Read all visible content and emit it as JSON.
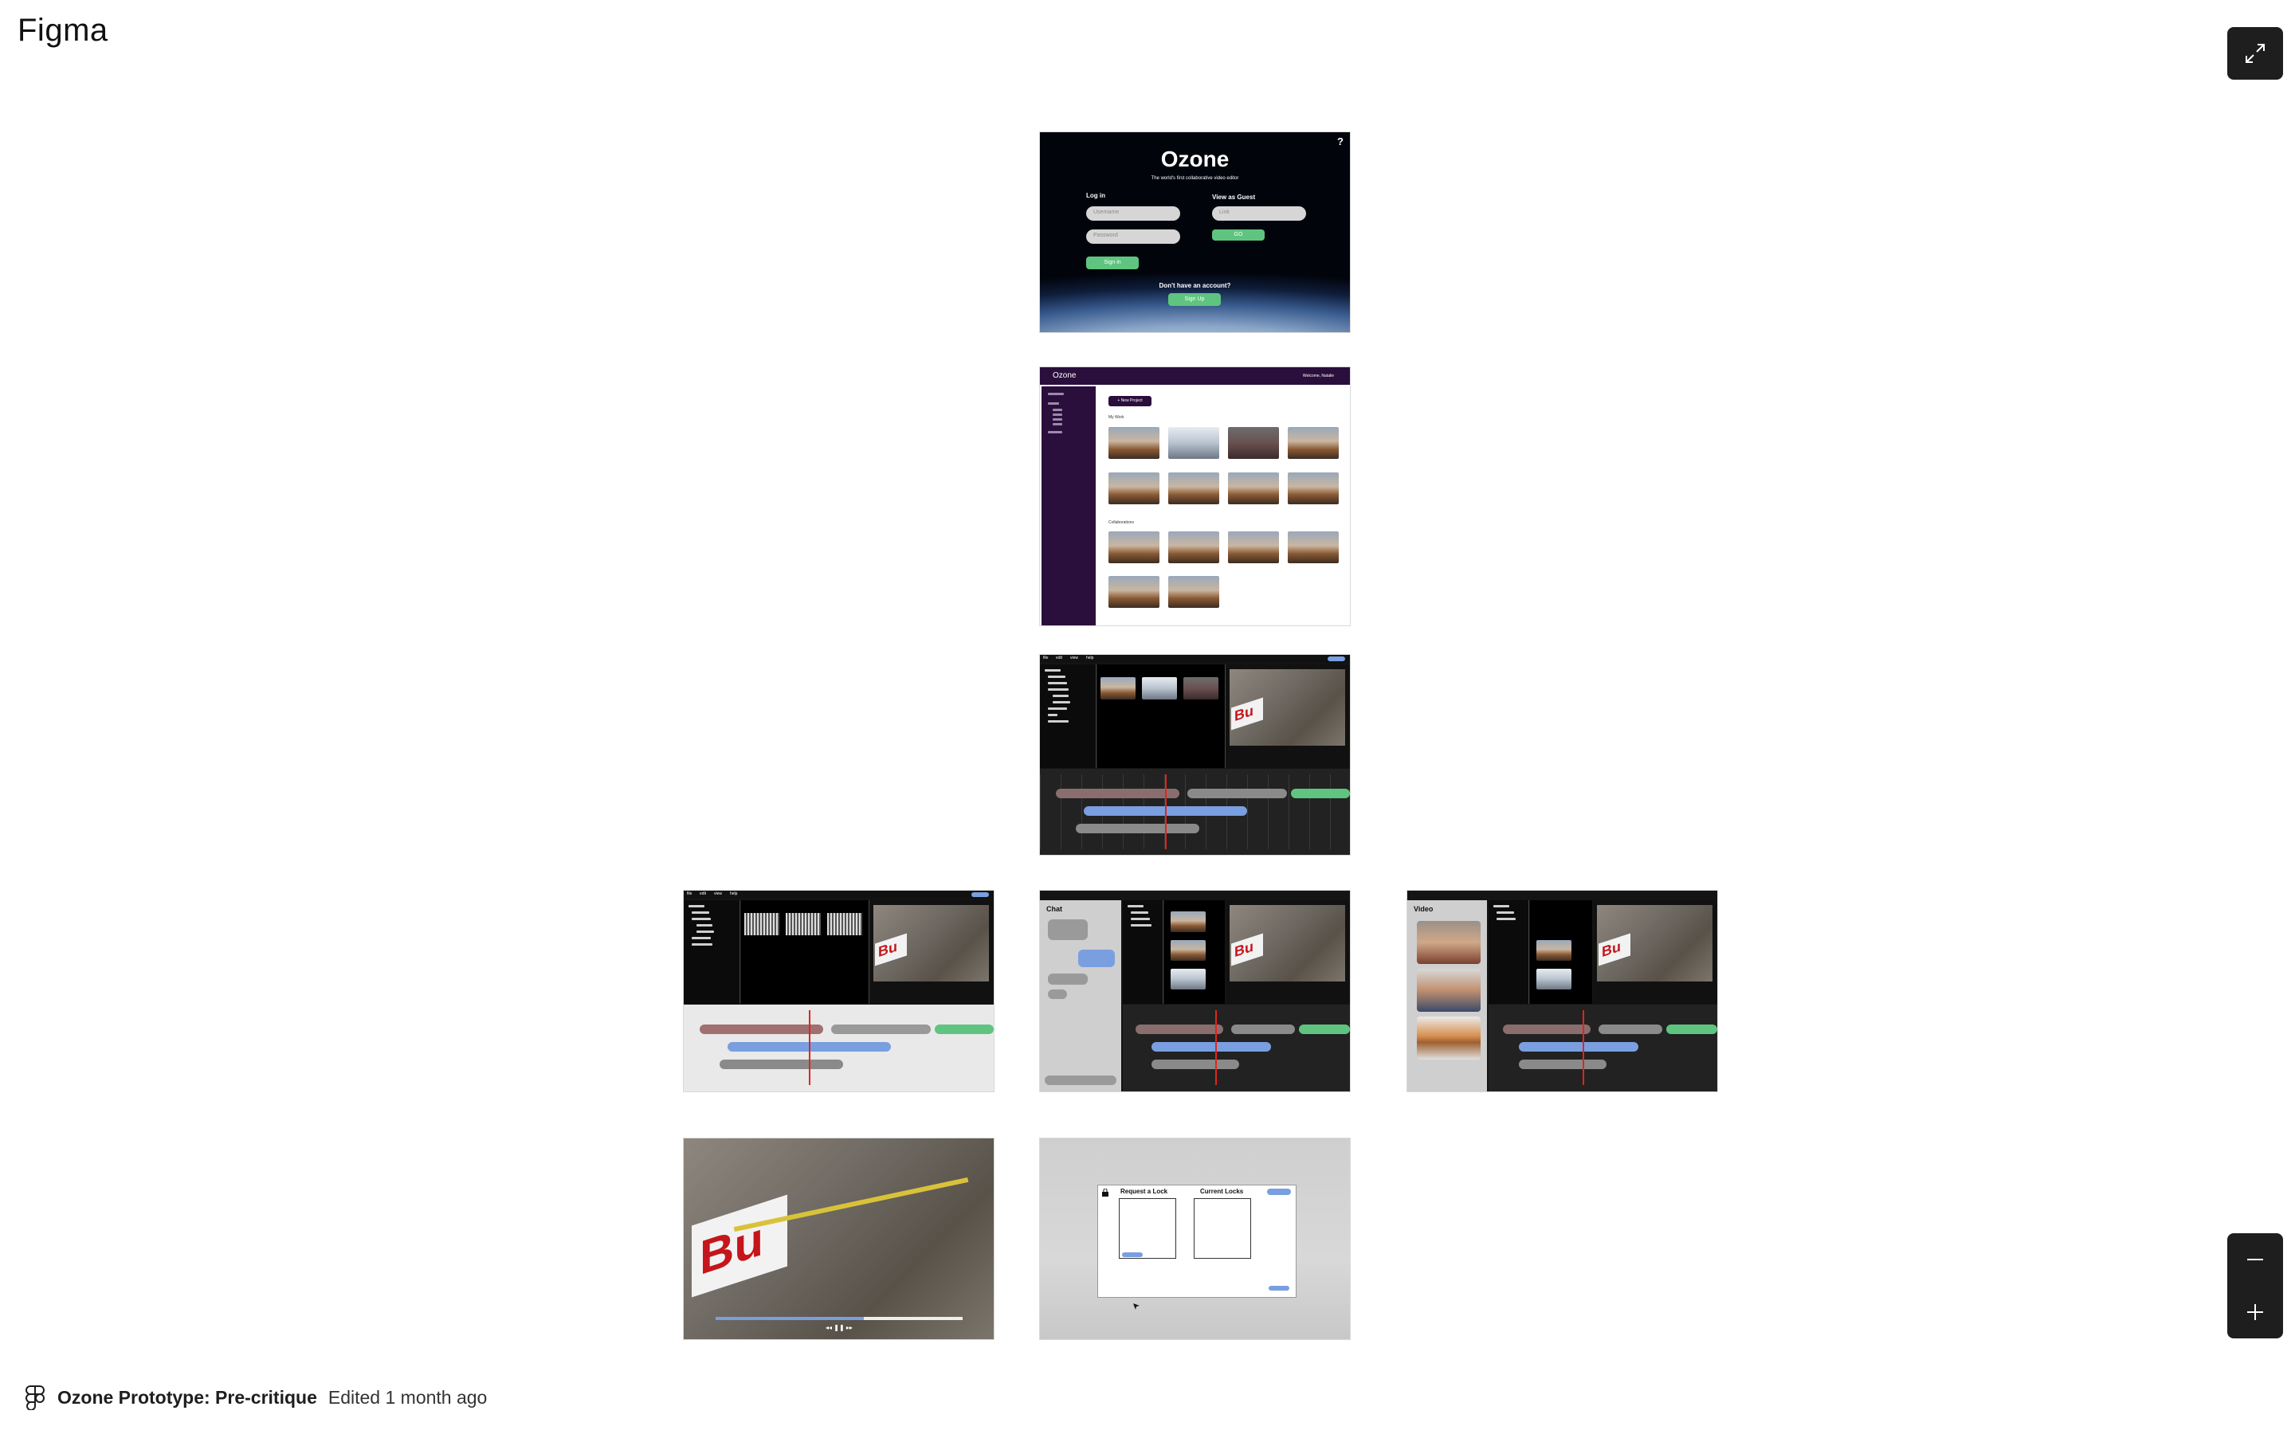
{
  "app": {
    "name": "Figma",
    "file_title": "Ozone Prototype: Pre-critique",
    "edited": "Edited 1 month ago"
  },
  "controls": {
    "expand_icon": "expand-arrows-icon",
    "zoom_out_icon": "minus-icon",
    "zoom_in_icon": "plus-icon"
  },
  "colors": {
    "brand_purple": "#2a0f3d",
    "accent_green": "#5fc47f",
    "accent_blue": "#7a9fe0",
    "accent_red": "#d9534f",
    "chrome_dark": "#1e1e1e"
  },
  "frames": {
    "login": {
      "title": "Ozone",
      "tagline": "The world's first collaborative video editor",
      "help": "?",
      "login_heading": "Log in",
      "username_placeholder": "Username",
      "password_placeholder": "Password",
      "sign_in": "Sign in",
      "guest_heading": "View as Guest",
      "link_placeholder": "Link",
      "go": "GO",
      "no_account": "Don't have an account?",
      "sign_up": "Sign Up"
    },
    "dashboard": {
      "brand": "Ozone",
      "welcome": "Welcome, Natalie",
      "new_project": "+ New Project",
      "section_my": "My Work",
      "section_collab": "Collaborations"
    },
    "chat": {
      "title": "Chat"
    },
    "video": {
      "title": "Video"
    },
    "lock": {
      "request_title": "Request a Lock",
      "current_title": "Current Locks"
    },
    "menus": [
      "file",
      "edit",
      "view",
      "help"
    ]
  }
}
